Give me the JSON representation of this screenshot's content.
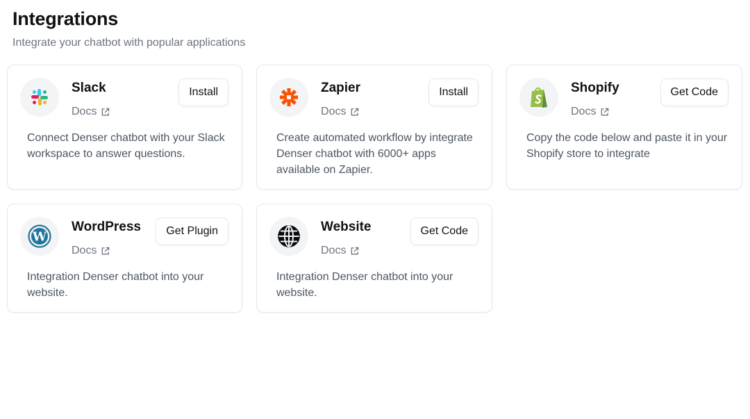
{
  "page": {
    "title": "Integrations",
    "subtitle": "Integrate your chatbot with popular applications"
  },
  "integrations": [
    {
      "name": "Slack",
      "docs_label": "Docs",
      "action_label": "Install",
      "description": "Connect Denser chatbot with your Slack workspace to answer questions.",
      "icon": "slack-logo"
    },
    {
      "name": "Zapier",
      "docs_label": "Docs",
      "action_label": "Install",
      "description": "Create automated workflow by integrate Denser chatbot with 6000+ apps available on Zapier.",
      "icon": "zapier-logo",
      "color": "#ff4f00"
    },
    {
      "name": "Shopify",
      "docs_label": "Docs",
      "action_label": "Get Code",
      "description": "Copy the code below and paste it in your Shopify store to integrate",
      "icon": "shopify-logo",
      "color": "#95bf47"
    },
    {
      "name": "WordPress",
      "docs_label": "Docs",
      "action_label": "Get Plugin",
      "description": "Integration Denser chatbot into your website.",
      "icon": "wordpress-logo",
      "color": "#21759b"
    },
    {
      "name": "Website",
      "docs_label": "Docs",
      "action_label": "Get Code",
      "description": "Integration Denser chatbot into your website.",
      "icon": "globe-icon"
    }
  ]
}
